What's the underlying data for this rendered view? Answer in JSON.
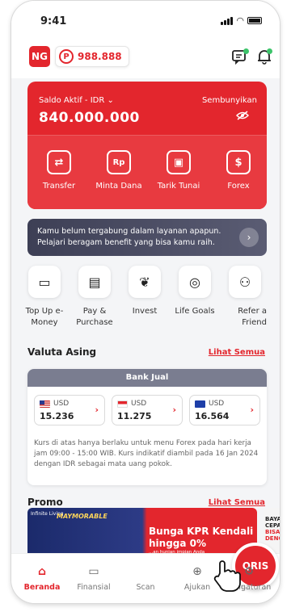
{
  "status": {
    "time": "9:41"
  },
  "header": {
    "user_initials": "NG",
    "points_symbol": "P",
    "points": "988.888"
  },
  "saldo": {
    "label": "Saldo Aktif - IDR ⌄",
    "value": "840.000.000",
    "hide_label": "Sembunyikan",
    "actions": [
      {
        "label": "Transfer",
        "icon": "transfer-icon"
      },
      {
        "label": "Minta Dana",
        "icon": "request-funds-icon"
      },
      {
        "label": "Tarik Tunai",
        "icon": "cash-withdraw-icon"
      },
      {
        "label": "Forex",
        "icon": "forex-icon"
      }
    ]
  },
  "banner": {
    "text": "Kamu belum tergabung dalam layanan apapun. Pelajari beragam benefit yang bisa kamu raih."
  },
  "menu": [
    {
      "label": "Top Up e-Money",
      "icon": "wallet-icon"
    },
    {
      "label": "Pay & Purchase",
      "icon": "bill-icon"
    },
    {
      "label": "Invest",
      "icon": "sprout-icon"
    },
    {
      "label": "Life Goals",
      "icon": "target-icon"
    },
    {
      "label": "Refer a Friend",
      "icon": "refer-icon"
    }
  ],
  "valuta": {
    "title": "Valuta Asing",
    "see_all": "Lihat Semua",
    "tab": "Bank Jual",
    "rates": [
      {
        "currency": "USD",
        "value": "15.236",
        "flag": "us-flag-icon"
      },
      {
        "currency": "USD",
        "value": "11.275",
        "flag": "sg-flag-icon"
      },
      {
        "currency": "USD",
        "value": "16.564",
        "flag": "eu-flag-icon"
      }
    ],
    "note": "Kurs di atas hanya berlaku untuk menu Forex pada hari kerja jam 09:00 - 15:00 WIB. Kurs indikatif diambil pada 16 Jan 2024 dengan IDR sebagai mata uang pokok."
  },
  "promo": {
    "title": "Promo",
    "see_all": "Lihat Semua",
    "card1_brand": "Infinite Living",
    "card1_tagline": "MAYMORABLE",
    "card1_title": "Bunga KPR Kendali hingga 0%",
    "card1_sub": "...an hunian impian Anda",
    "card2_lines": [
      "BAYAR",
      "CEPAT",
      "BISA D",
      "DENGA"
    ]
  },
  "nav": {
    "items": [
      {
        "label": "Beranda",
        "icon": "home-icon"
      },
      {
        "label": "Finansial",
        "icon": "cash-icon"
      },
      {
        "label": "Scan",
        "icon": "qris-icon"
      },
      {
        "label": "Ajukan",
        "icon": "plus-circle-icon"
      },
      {
        "label": "Pengaturan",
        "icon": "settings-icon"
      }
    ],
    "qris_label": "QRIS"
  },
  "colors": {
    "brand": "#e3262d",
    "banner": "#4a4c63",
    "accent_green": "#3cc46a"
  }
}
